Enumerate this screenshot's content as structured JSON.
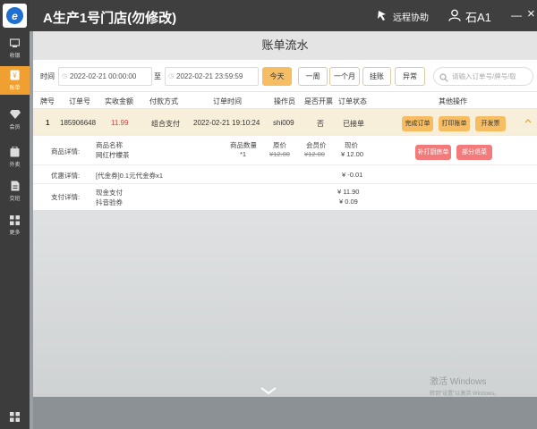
{
  "app": {
    "title": "A生产1号门店(勿修改)"
  },
  "topbar": {
    "remote_label": "远程协助",
    "user_name": "石A1",
    "minimize": "—",
    "close": "×"
  },
  "sidebar": {
    "items": [
      {
        "label": "收银",
        "icon": "cashier-icon"
      },
      {
        "label": "账单",
        "icon": "bill-icon",
        "active": true
      },
      {
        "label": "会员",
        "icon": "diamond-icon"
      },
      {
        "label": "外卖",
        "icon": "takeout-icon"
      },
      {
        "label": "交班",
        "icon": "shift-icon"
      },
      {
        "label": "更多",
        "icon": "more-icon"
      }
    ]
  },
  "page": {
    "title": "账单流水"
  },
  "filter": {
    "time_label": "时间",
    "start": "2022-02-21 00:00:00",
    "to_label": "至",
    "end": "2022-02-21 23:59:59",
    "buttons": [
      "今天",
      "一周",
      "一个月",
      "挂账",
      "异常"
    ],
    "search_placeholder": "请输入订单号/牌号/取"
  },
  "table": {
    "headers": [
      "牌号",
      "订单号",
      "实收金额",
      "付款方式",
      "订单时间",
      "操作员",
      "是否开票",
      "订单状态",
      "其他操作"
    ],
    "row": {
      "no": "1",
      "order": "185906648",
      "amount": "11.99",
      "pay": "组合支付",
      "time": "2022-02-21 19:10:24",
      "operator": "shi009",
      "invoiced": "否",
      "status": "已接单",
      "actions": [
        "完成订单",
        "打印账单",
        "开发票"
      ]
    }
  },
  "detail": {
    "goods_label": "商品详情:",
    "goods_headers": [
      "商品名称",
      "商品数量",
      "原价",
      "会员价",
      "现价"
    ],
    "goods": [
      {
        "name": "网红柠檬茶",
        "qty": "*1",
        "orig": "¥12.00",
        "member": "¥12.00",
        "now": "¥ 12.00"
      }
    ],
    "reprint_btn": "补打厨房单",
    "refund_btn": "部分退菜",
    "discount_label": "优惠详情:",
    "discount_item": "[代金券]0.1元代金券x1",
    "discount_value": "¥ -0.01",
    "pay_label": "支付详情:",
    "pay_items": [
      {
        "name": "现金支付",
        "value": "¥ 11.90"
      },
      {
        "name": "抖音验券",
        "value": "¥ 0.09"
      }
    ]
  },
  "watermark": {
    "title": "激活 Windows",
    "sub": "转到\"设置\"以激活 Windows。"
  }
}
